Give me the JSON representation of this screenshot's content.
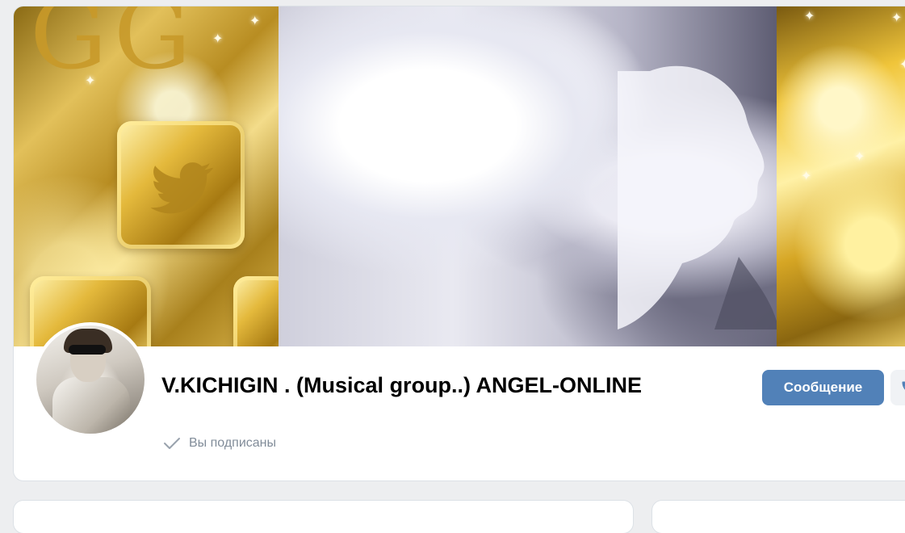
{
  "profile": {
    "title": "V.KICHIGIN . (Musical group..) ANGEL-ONLINE",
    "subscription_status": "Вы подписаны",
    "subscription_icon": "check-icon"
  },
  "actions": {
    "message_label": "Сообщение",
    "call_icon": "phone-icon"
  },
  "cover": {
    "panels": [
      "gold-twitter-tiles",
      "portrait-woman-curly-hair",
      "gold-crystals"
    ]
  },
  "colors": {
    "accent": "#5181b8",
    "muted_text": "#818c99",
    "page_background": "#edeef0"
  }
}
